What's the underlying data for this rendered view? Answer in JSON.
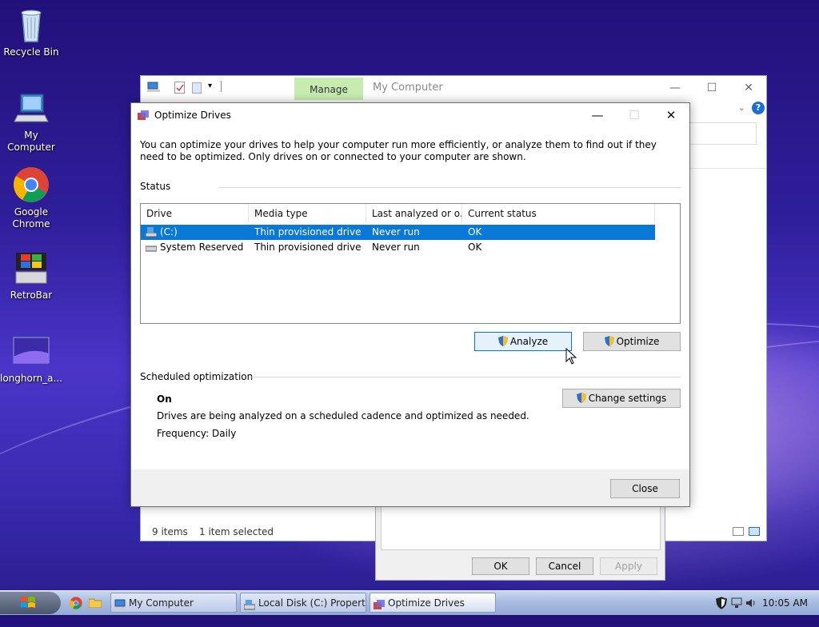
{
  "desktop": {
    "icons": [
      {
        "label": "Recycle Bin"
      },
      {
        "label": "My Computer"
      },
      {
        "label": "Google Chrome"
      },
      {
        "label": "RetroBar"
      },
      {
        "label": "longhorn_a..."
      }
    ]
  },
  "explorer": {
    "manage_tab": "Manage",
    "title": "My Computer",
    "status_items": "9 items",
    "status_selected": "1 item selected"
  },
  "properties_dialog": {
    "ok": "OK",
    "cancel": "Cancel",
    "apply": "Apply"
  },
  "optimize": {
    "title": "Optimize Drives",
    "description": "You can optimize your drives to help your computer run more efficiently, or analyze them to find out if they need to be optimized. Only drives on or connected to your computer are shown.",
    "status_label": "Status",
    "columns": [
      "Drive",
      "Media type",
      "Last analyzed or o...",
      "Current status"
    ],
    "rows": [
      {
        "drive": "(C:)",
        "media": "Thin provisioned drive",
        "last": "Never run",
        "status": "OK",
        "selected": true
      },
      {
        "drive": "System Reserved",
        "media": "Thin provisioned drive",
        "last": "Never run",
        "status": "OK",
        "selected": false
      }
    ],
    "analyze": "Analyze",
    "optimize_btn": "Optimize",
    "scheduled_label": "Scheduled optimization",
    "schedule_state": "On",
    "schedule_desc": "Drives are being analyzed on a scheduled cadence and optimized as needed.",
    "frequency": "Frequency: Daily",
    "change_settings": "Change settings",
    "close": "Close"
  },
  "taskbar": {
    "buttons": [
      {
        "label": "My Computer"
      },
      {
        "label": "Local Disk (C:) Properti..."
      },
      {
        "label": "Optimize Drives"
      }
    ],
    "time": "10:05 AM"
  },
  "colors": {
    "selection": "#0a78d7",
    "manage_tab": "#c6ecb0",
    "help": "#1a6fd0"
  }
}
